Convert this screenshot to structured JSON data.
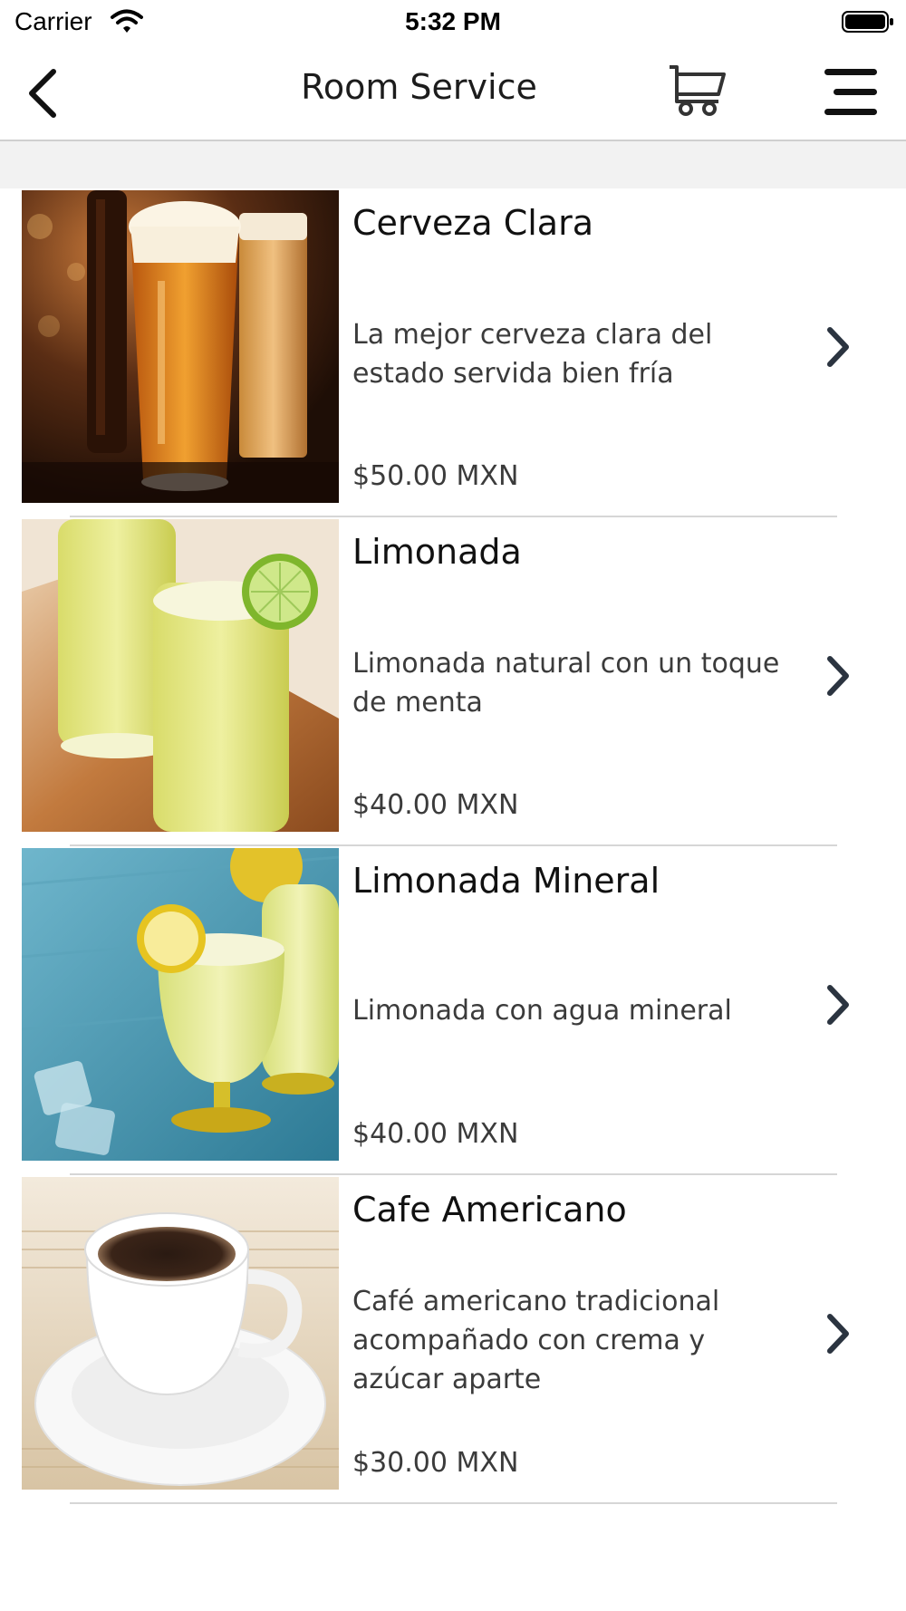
{
  "status_bar": {
    "carrier": "Carrier",
    "time": "5:32 PM",
    "wifi_icon": "wifi-icon",
    "battery_icon": "battery-icon"
  },
  "nav": {
    "title": "Room Service",
    "back_icon": "chevron-left-icon",
    "cart_icon": "cart-icon",
    "menu_icon": "hamburger-menu-icon"
  },
  "items": [
    {
      "name": "Cerveza Clara",
      "description": "La mejor cerveza clara del estado servida bien fría",
      "price": "$50.00 MXN",
      "image": "beer-glasses-photo"
    },
    {
      "name": "Limonada",
      "description": "Limonada natural con un toque de menta",
      "price": "$40.00 MXN",
      "image": "lemonade-glasses-photo"
    },
    {
      "name": "Limonada Mineral",
      "description": "Limonada con agua mineral",
      "price": "$40.00 MXN",
      "image": "mineral-lemonade-photo"
    },
    {
      "name": "Cafe Americano",
      "description": "Café americano tradicional acompañado con crema y azúcar aparte",
      "price": "$30.00 MXN",
      "image": "coffee-cup-photo"
    }
  ],
  "colors": {
    "chevron": "#2b3440",
    "divider": "#d6d6d6",
    "band": "#f2f2f2"
  }
}
